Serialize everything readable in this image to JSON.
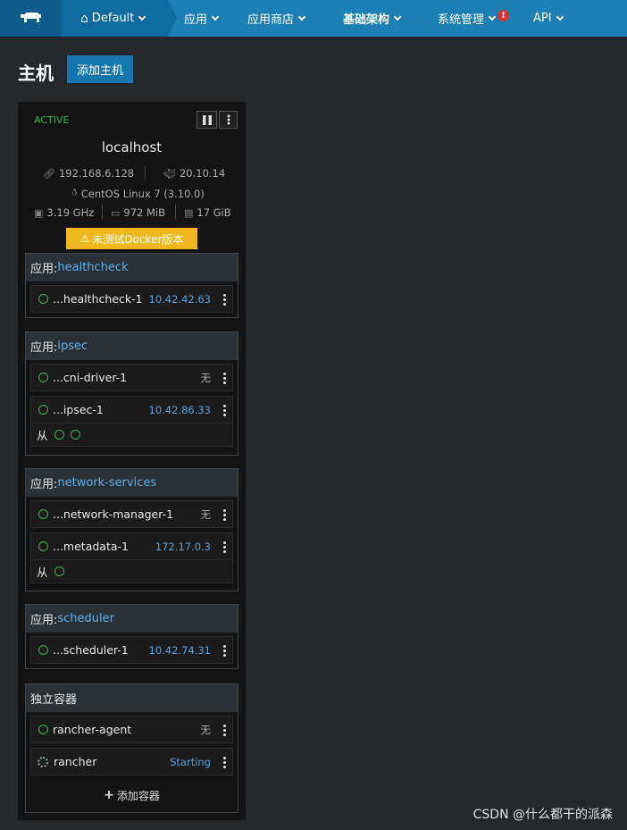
{
  "nav": {
    "env": "Default",
    "items": [
      "应用",
      "应用商店",
      "基础架构",
      "系统管理",
      "API"
    ],
    "alert": "!"
  },
  "page": {
    "title": "主机",
    "add_host": "添加主机"
  },
  "host": {
    "state": "ACTIVE",
    "name": "localhost",
    "ip": "192.168.6.128",
    "docker": "20.10.14",
    "os": "CentOS Linux 7 (3.10.0)",
    "cpu": "3.19 GHz",
    "mem": "972 MiB",
    "disk": "17 GiB",
    "warning": "未测试Docker版本"
  },
  "stacks": [
    {
      "prefix": "应用:",
      "name": "healthcheck",
      "rows": [
        {
          "name": "...healthcheck-1",
          "value": "10.42.42.63"
        }
      ]
    },
    {
      "prefix": "应用:",
      "name": "ipsec",
      "rows": [
        {
          "name": "...cni-driver-1",
          "value": "无"
        },
        {
          "name": "...ipsec-1",
          "value": "10.42.86.33"
        }
      ],
      "sidekick": "从"
    },
    {
      "prefix": "应用:",
      "name": "network-services",
      "rows": [
        {
          "name": "...network-manager-1",
          "value": "无"
        },
        {
          "name": "...metadata-1",
          "value": "172.17.0.3"
        }
      ],
      "sidekick": "从"
    },
    {
      "prefix": "应用:",
      "name": "scheduler",
      "rows": [
        {
          "name": "...scheduler-1",
          "value": "10.42.74.31"
        }
      ]
    }
  ],
  "standalone": {
    "title": "独立容器",
    "rows": [
      {
        "name": "rancher-agent",
        "value": "无"
      },
      {
        "name": "rancher",
        "value": "Starting"
      }
    ],
    "add": "添加容器"
  },
  "watermark": "CSDN @什么都干的派森"
}
